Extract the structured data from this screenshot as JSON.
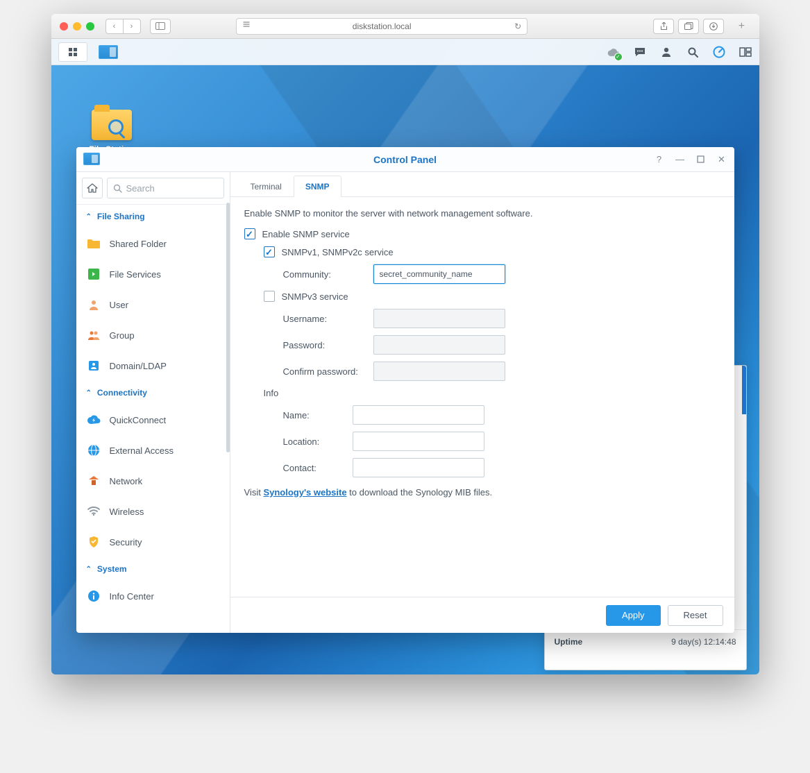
{
  "browser": {
    "url": "diskstation.local"
  },
  "desktop": {
    "shortcut_label": "File Station"
  },
  "widget": {
    "uptime_label": "Uptime",
    "uptime_value": "9 day(s) 12:14:48"
  },
  "window": {
    "title": "Control Panel",
    "search_placeholder": "Search",
    "sections": {
      "file_sharing": "File Sharing",
      "connectivity": "Connectivity",
      "system": "System"
    },
    "sidebar": {
      "shared_folder": "Shared Folder",
      "file_services": "File Services",
      "user": "User",
      "group": "Group",
      "domain_ldap": "Domain/LDAP",
      "quickconnect": "QuickConnect",
      "external_access": "External Access",
      "network": "Network",
      "wireless": "Wireless",
      "security": "Security",
      "info_center": "Info Center"
    },
    "tabs": {
      "terminal": "Terminal",
      "snmp": "SNMP"
    },
    "form": {
      "intro": "Enable SNMP to monitor the server with network management software.",
      "enable_snmp": "Enable SNMP service",
      "v12c": "SNMPv1, SNMPv2c service",
      "community_label": "Community:",
      "community_value": "secret_community_name",
      "v3": "SNMPv3 service",
      "username_label": "Username:",
      "username_value": "",
      "password_label": "Password:",
      "password_value": "",
      "confirm_label": "Confirm password:",
      "confirm_value": "",
      "info_head": "Info",
      "name_label": "Name:",
      "name_value": "",
      "location_label": "Location:",
      "location_value": "",
      "contact_label": "Contact:",
      "contact_value": "",
      "mib_pre": "Visit ",
      "mib_link": "Synology's website",
      "mib_post": " to download the Synology MIB files."
    },
    "buttons": {
      "apply": "Apply",
      "reset": "Reset"
    }
  }
}
